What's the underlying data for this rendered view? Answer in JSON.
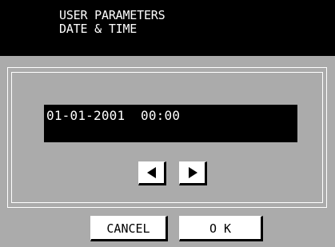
{
  "header": {
    "line1": "USER PARAMETERS",
    "line2": "DATE & TIME"
  },
  "display": {
    "value": "01-01-2001  00:00"
  },
  "arrows": {
    "left_icon": "arrow-left-icon",
    "right_icon": "arrow-right-icon"
  },
  "buttons": {
    "cancel_label": "CANCEL",
    "ok_label": "O K"
  },
  "colors": {
    "header_background": "#000000",
    "header_text": "#ffffff",
    "panel_dither": "#c2c2c2",
    "button_face": "#ffffff",
    "button_shadow": "#000000"
  }
}
